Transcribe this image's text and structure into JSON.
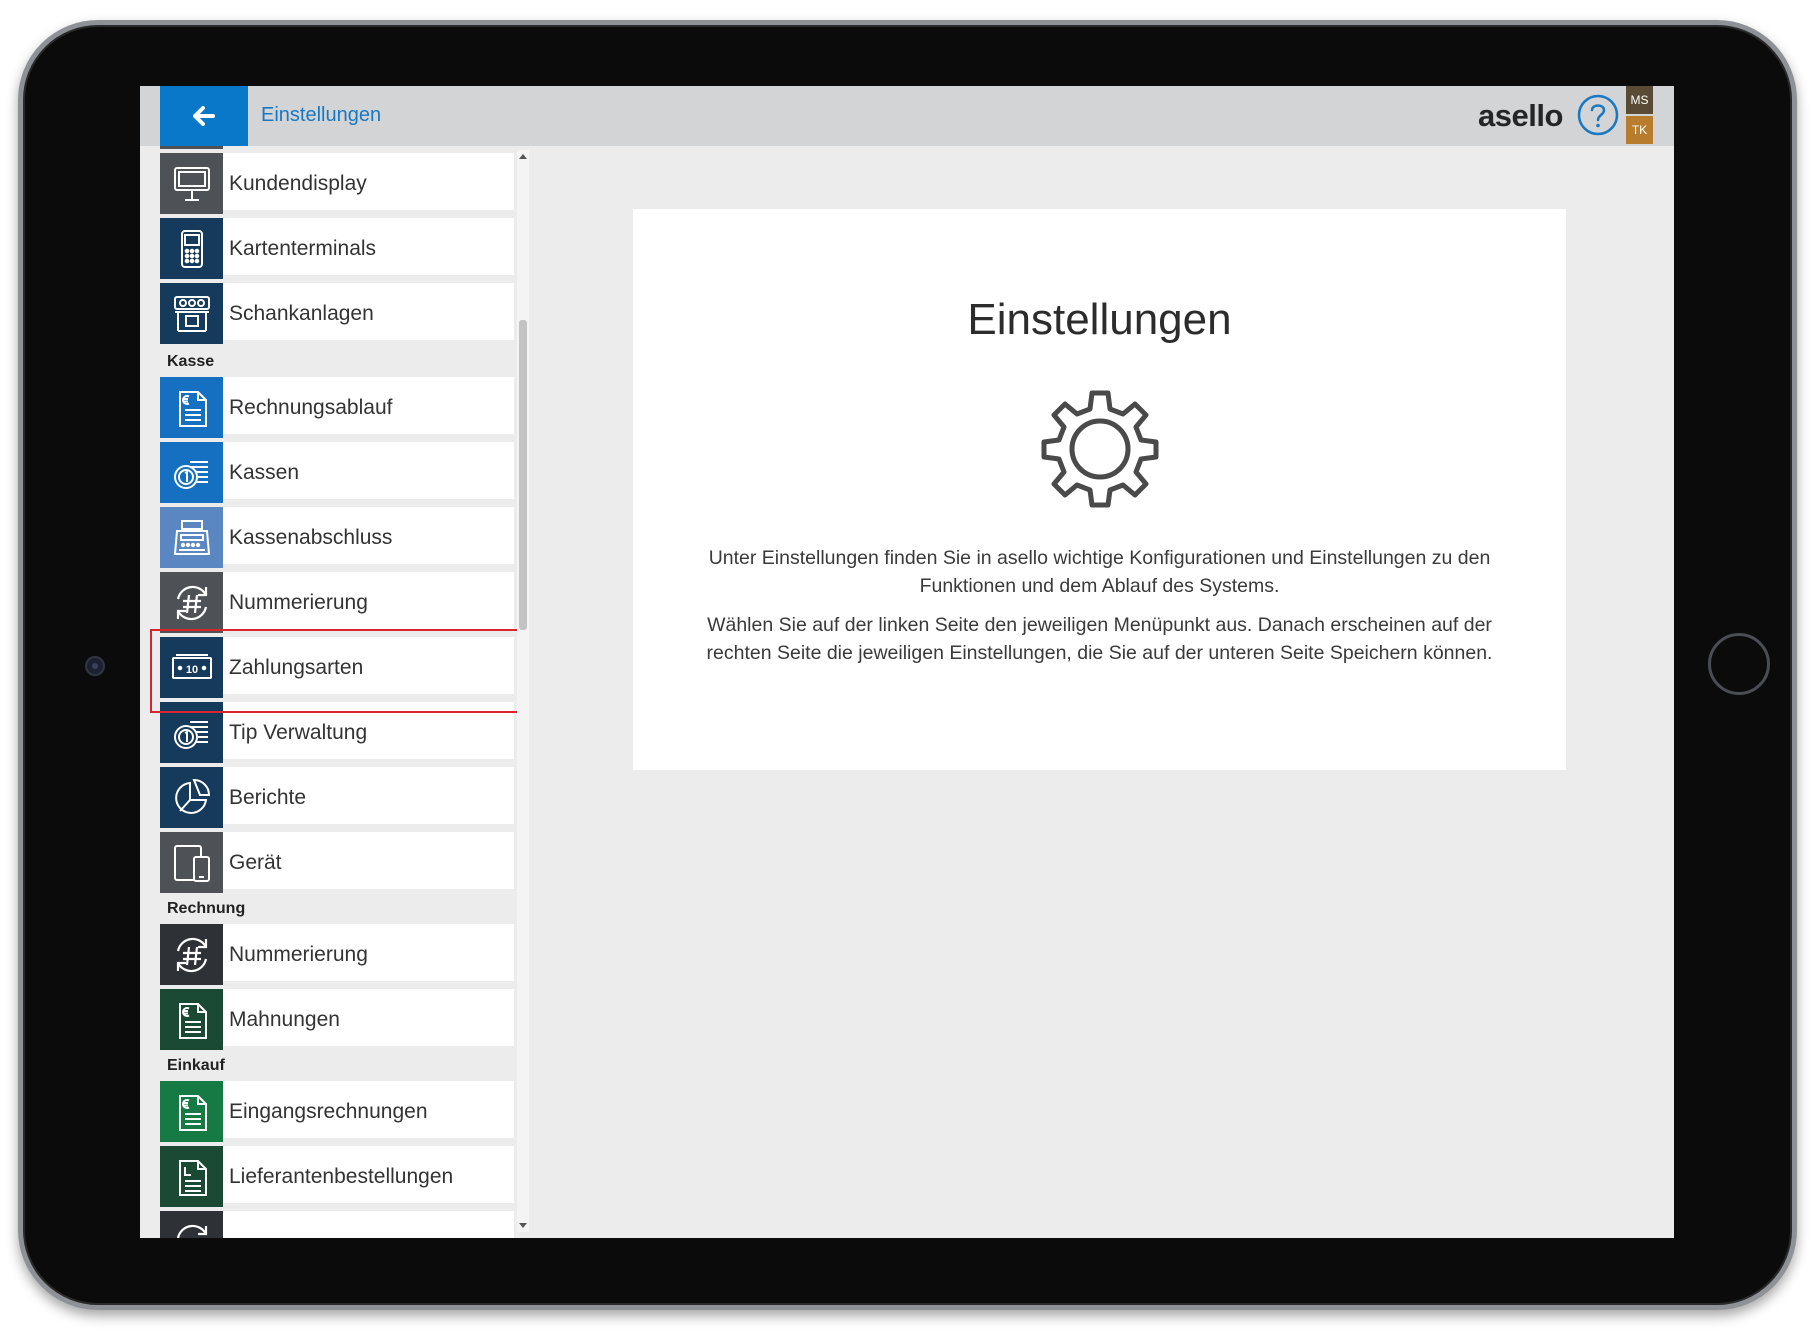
{
  "header": {
    "title": "Einstellungen",
    "brand": "asello",
    "user_badge_top": "MS",
    "user_badge_bottom": "TK"
  },
  "sidebar": {
    "items_top": [
      {
        "label": "Kundendisplay",
        "icon": "customer-display-icon",
        "color": "#4e5257"
      },
      {
        "label": "Kartenterminals",
        "icon": "card-terminal-icon",
        "color": "#163a5b"
      },
      {
        "label": "Schankanlagen",
        "icon": "tap-system-icon",
        "color": "#163a5b"
      }
    ],
    "sections": [
      {
        "title": "Kasse",
        "items": [
          {
            "label": "Rechnungsablauf",
            "icon": "invoice-icon",
            "color": "#1570c1"
          },
          {
            "label": "Kassen",
            "icon": "coins-icon",
            "color": "#1570c1"
          },
          {
            "label": "Kassenabschluss",
            "icon": "cash-register-icon",
            "color": "#5a87c2"
          },
          {
            "label": "Nummerierung",
            "icon": "numbering-icon",
            "color": "#4e5257"
          },
          {
            "label": "Zahlungsarten",
            "icon": "banknote-icon",
            "color": "#163a5b"
          },
          {
            "label": "Tip Verwaltung",
            "icon": "coins-icon",
            "color": "#163a5b"
          },
          {
            "label": "Berichte",
            "icon": "pie-chart-icon",
            "color": "#163a5b"
          },
          {
            "label": "Gerät",
            "icon": "device-icon",
            "color": "#4e5257"
          }
        ]
      },
      {
        "title": "Rechnung",
        "items": [
          {
            "label": "Nummerierung",
            "icon": "numbering-icon",
            "color": "#2e3135"
          },
          {
            "label": "Mahnungen",
            "icon": "invoice-icon",
            "color": "#1a4a34"
          }
        ]
      },
      {
        "title": "Einkauf",
        "items": [
          {
            "label": "Eingangsrechnungen",
            "icon": "invoice-icon",
            "color": "#157a43"
          },
          {
            "label": "Lieferantenbestellungen",
            "icon": "order-document-icon",
            "color": "#1a4a34"
          }
        ]
      }
    ]
  },
  "content": {
    "title": "Einstellungen",
    "paragraph_1": "Unter Einstellungen finden Sie in asello wichtige Konfigurationen und Einstellungen zu den Funktionen und dem Ablauf des Systems.",
    "paragraph_2": "Wählen Sie auf der linken Seite den jeweiligen Menüpunkt aus. Danach erscheinen auf der rechten Seite die jeweiligen Einstellungen, die Sie auf der unteren Seite Speichern können."
  },
  "colors": {
    "accent": "#0a78c8",
    "highlight": "#d9262d"
  }
}
